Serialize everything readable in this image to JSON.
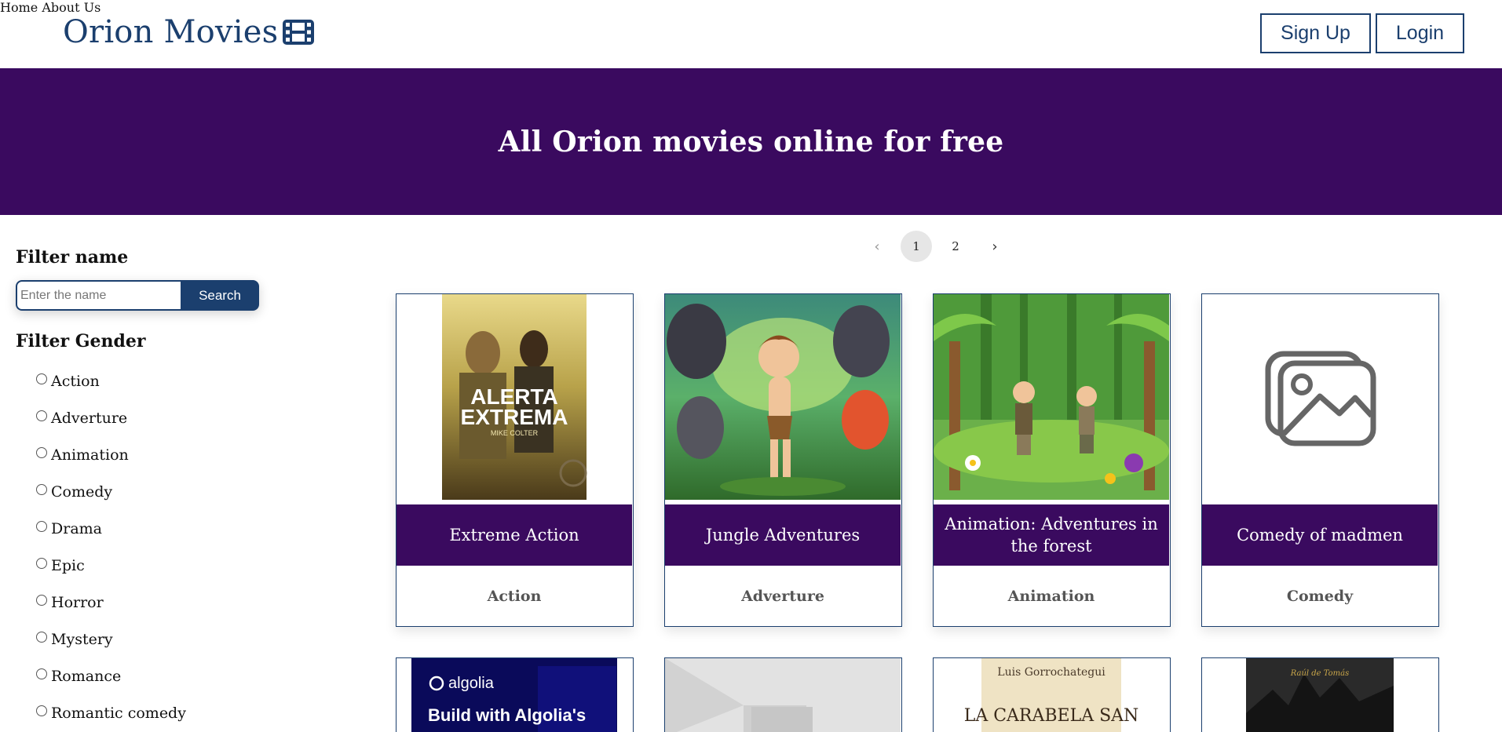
{
  "header": {
    "brand": "Orion Movies",
    "brand_icon": "film-icon",
    "nav": [
      {
        "label": "Home"
      },
      {
        "label": "About Us"
      }
    ],
    "signup_label": "Sign Up",
    "login_label": "Login"
  },
  "hero": {
    "title": "All Orion movies online for free"
  },
  "sidebar": {
    "filter_name_title": "Filter name",
    "search_placeholder": "Enter the name",
    "search_button": "Search",
    "filter_gender_title": "Filter Gender",
    "genres": [
      "Action",
      "Adverture",
      "Animation",
      "Comedy",
      "Drama",
      "Epic",
      "Horror",
      "Mystery",
      "Romance",
      "Romantic comedy"
    ]
  },
  "pagination": {
    "prev_icon": "chevron-left-icon",
    "pages": [
      "1",
      "2"
    ],
    "current": "1",
    "next_icon": "chevron-right-icon"
  },
  "movies": [
    {
      "title": "Extreme Action",
      "genre": "Action",
      "poster_text": "ALERTA EXTREMA",
      "poster_sub": "MIKE COLTER"
    },
    {
      "title": "Jungle Adventures",
      "genre": "Adverture"
    },
    {
      "title": "Animation: Adventures in the forest",
      "genre": "Animation"
    },
    {
      "title": "Comedy of madmen",
      "genre": "Comedy",
      "image_icon": "image-placeholder-icon"
    }
  ],
  "movies_row2": [
    {
      "poster_brand": "algolia",
      "poster_text": "Build with Algolia's"
    },
    {
      "image_icon": "image-placeholder-icon"
    },
    {
      "poster_author": "Luis Gorrochategui",
      "poster_text": "LA CARABELA SAN"
    },
    {
      "poster_text": "Raúl de Tomás"
    }
  ],
  "colors": {
    "primary": "#1b3f6e",
    "hero_bg": "#3a0a5f"
  }
}
